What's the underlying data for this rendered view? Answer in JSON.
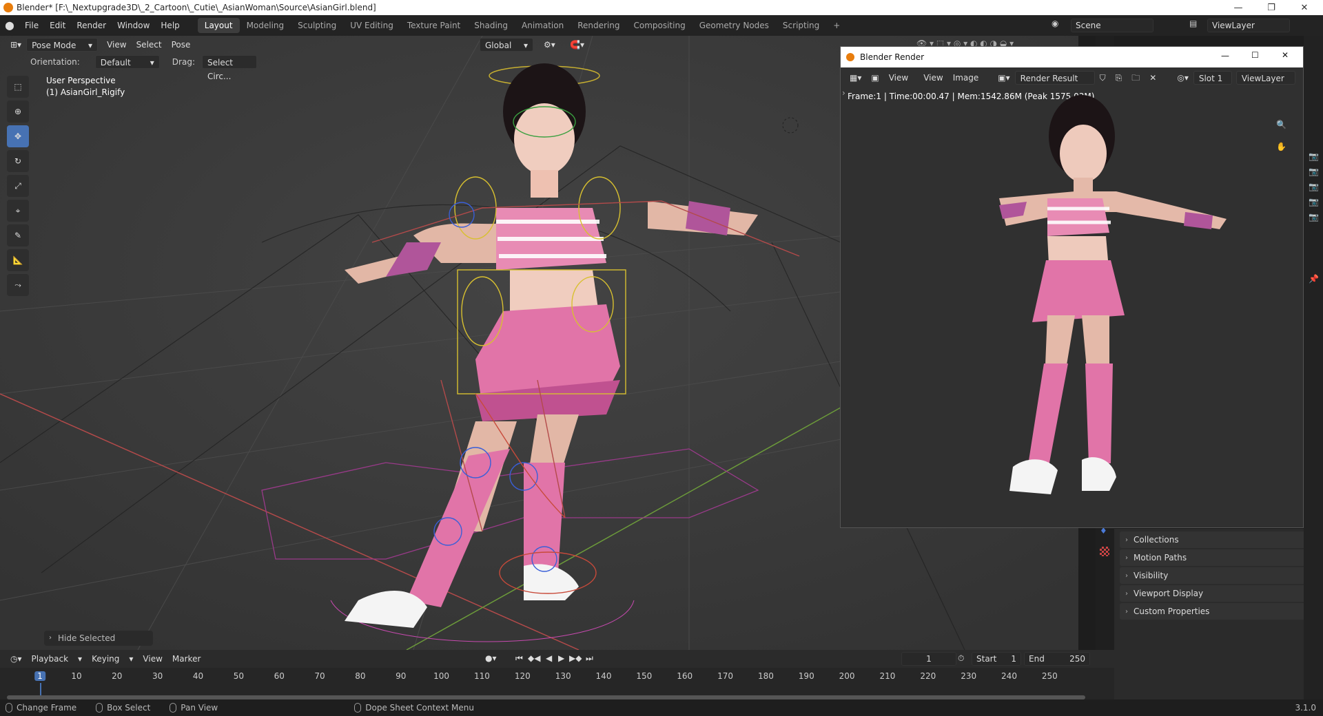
{
  "window": {
    "title": "Blender* [F:\\_Nextupgrade3D\\_2_Cartoon\\_Cutie\\_AsianWoman\\Source\\AsianGirl.blend]"
  },
  "menu": [
    "File",
    "Edit",
    "Render",
    "Window",
    "Help"
  ],
  "workspaces": [
    "Layout",
    "Modeling",
    "Sculpting",
    "UV Editing",
    "Texture Paint",
    "Shading",
    "Animation",
    "Rendering",
    "Compositing",
    "Geometry Nodes",
    "Scripting"
  ],
  "workspace_add": "+",
  "scene": {
    "label": "Scene",
    "view_layer": "ViewLayer"
  },
  "viewport": {
    "mode": "Pose Mode",
    "header_menus": [
      "View",
      "Select",
      "Pose"
    ],
    "transform_orientation": "Global",
    "orientation_label": "Orientation:",
    "orientation_value": "Default",
    "drag_label": "Drag:",
    "drag_value": "Select Circ...",
    "overlay_line1": "User Perspective",
    "overlay_line2": "(1) AsianGirl_Rigify",
    "hide_selected": "Hide Selected"
  },
  "render_window": {
    "title": "Blender Render",
    "menus": [
      "View",
      "View",
      "Image"
    ],
    "result": "Render Result",
    "slot": "Slot 1",
    "view_layer": "ViewLayer",
    "info": "Frame:1 | Time:00:00.47 | Mem:1542.86M (Peak 1575.03M)"
  },
  "properties": {
    "sections": [
      "Collections",
      "Motion Paths",
      "Visibility",
      "Viewport Display",
      "Custom Properties"
    ]
  },
  "timeline": {
    "menus": [
      "Playback",
      "Keying",
      "View",
      "Marker"
    ],
    "current_frame": "1",
    "start_label": "Start",
    "start": "1",
    "end_label": "End",
    "end": "250",
    "ticks": [
      "1",
      "10",
      "20",
      "30",
      "40",
      "50",
      "60",
      "70",
      "80",
      "90",
      "100",
      "110",
      "120",
      "130",
      "140",
      "150",
      "160",
      "170",
      "180",
      "190",
      "200",
      "210",
      "220",
      "230",
      "240",
      "250"
    ]
  },
  "statusbar": {
    "items": [
      "Change Frame",
      "Box Select",
      "Pan View",
      "Dope Sheet Context Menu"
    ],
    "version": "3.1.0"
  },
  "colors": {
    "accent": "#4772b3",
    "active_frame": "#4772b3",
    "bg": "#3c3c3c"
  }
}
